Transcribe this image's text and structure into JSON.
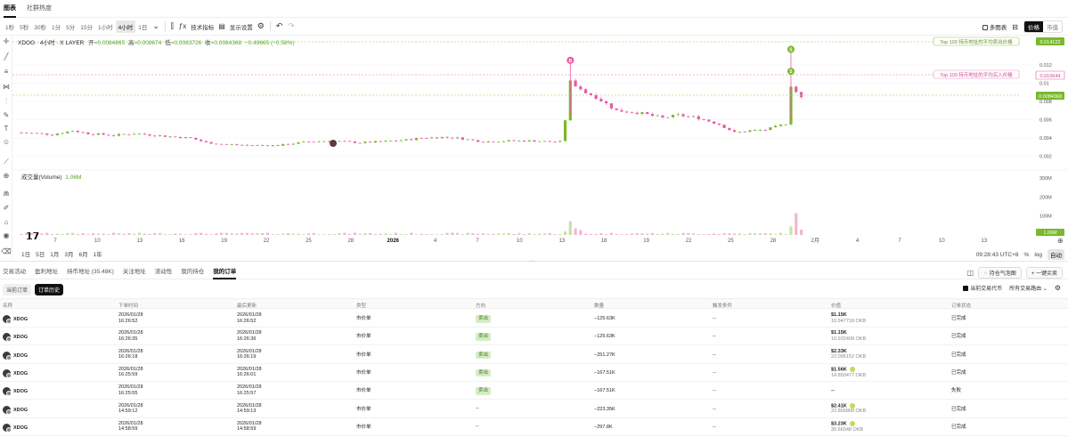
{
  "top_tabs": [
    "图表",
    "社群热度"
  ],
  "toolbar": {
    "intervals": [
      "1秒",
      "5秒",
      "30秒",
      "1分",
      "5分",
      "15分",
      "1小时",
      "4小时",
      "1日"
    ],
    "active_interval": "4小时",
    "indicators_label": "技术指标",
    "display_label": "显示设置",
    "multi_chart_label": "多图表",
    "price_label": "价格",
    "mcap_label": "市值"
  },
  "legend": {
    "symbol": "XDOG · 4小时 · X LAYER",
    "o_label": "开",
    "o_value": "=0.0084865",
    "h_label": "高",
    "h_value": "=0.008674",
    "l_label": "低",
    "l_value": "=0.0083726",
    "c_label": "收",
    "c_value": "=0.0084368",
    "change": "−0.49665 (−0.58%)"
  },
  "annotations": {
    "top_sell": "Top 100 持币地址的平均卖出价格",
    "top_buy": "Top 100 持币地址的平均买入价格",
    "sell_price": "0.014122",
    "buy_price": "0.010644",
    "current_price": "0.0084368"
  },
  "volume_legend": {
    "label": "成交量(Volume)",
    "value": "1.06M"
  },
  "time": "09:28:43 UTC+8",
  "range_buttons": [
    "1日",
    "5日",
    "1月",
    "3月",
    "6月",
    "1年"
  ],
  "scale_buttons": [
    "%",
    "log",
    "自动"
  ],
  "panel_tabs": [
    "交易活动",
    "盈利地址",
    "持币地址 (35.48K)",
    "关注地址",
    "流动性",
    "我的持仓",
    "我的订单"
  ],
  "panel_right": {
    "sentiment_label": "持仓气泡图",
    "sell_all_label": "一键买卖"
  },
  "sub_tabs": [
    "当前订单",
    "订单历史"
  ],
  "sub_right": {
    "filter_label": "当前交易代币",
    "group_label": "所有交易路由"
  },
  "table_headers": [
    "名称",
    "下单时间",
    "最后更新",
    "类型",
    "方向",
    "数量",
    "触发条件",
    "价值",
    "订单状态"
  ],
  "orders": [
    {
      "name": "XDOG",
      "order_date": "2026/01/28",
      "order_time": "16:26:52",
      "upd_date": "2026/01/28",
      "upd_time": "16:26:52",
      "type": "市价单",
      "side": "卖出",
      "qty": "−125.63K",
      "trigger": "--",
      "value": "$1.15K",
      "value_sub": "10.947718 OKB",
      "status": "已完成",
      "status_kind": "done",
      "badge": false
    },
    {
      "name": "XDOG",
      "order_date": "2026/01/28",
      "order_time": "16:26:35",
      "upd_date": "2026/01/28",
      "upd_time": "16:26:36",
      "type": "市价单",
      "side": "卖出",
      "qty": "−125.63K",
      "trigger": "--",
      "value": "$1.15K",
      "value_sub": "10.932408 OKB",
      "status": "已完成",
      "status_kind": "done",
      "badge": false
    },
    {
      "name": "XDOG",
      "order_date": "2026/01/28",
      "order_time": "16:26:18",
      "upd_date": "2026/01/28",
      "upd_time": "16:26:19",
      "type": "市价单",
      "side": "卖出",
      "qty": "−251.27K",
      "trigger": "--",
      "value": "$2.33K",
      "value_sub": "22.095152 OKB",
      "status": "已完成",
      "status_kind": "done",
      "badge": false
    },
    {
      "name": "XDOG",
      "order_date": "2026/01/28",
      "order_time": "16:25:59",
      "upd_date": "2026/01/28",
      "upd_time": "16:26:01",
      "type": "市价单",
      "side": "卖出",
      "qty": "−167.51K",
      "trigger": "--",
      "value": "$1.56K",
      "value_sub": "14.850477 OKB",
      "status": "已完成",
      "status_kind": "done",
      "badge": true
    },
    {
      "name": "XDOG",
      "order_date": "2026/01/28",
      "order_time": "16:25:55",
      "upd_date": "2026/01/28",
      "upd_time": "16:25:57",
      "type": "市价单",
      "side": "卖出",
      "qty": "−167.51K",
      "trigger": "--",
      "value": "--",
      "value_sub": "",
      "status": "失败",
      "status_kind": "fail",
      "badge": false
    },
    {
      "name": "XDOG",
      "order_date": "2026/01/28",
      "order_time": "14:59:12",
      "upd_date": "2026/01/28",
      "upd_time": "14:59:13",
      "type": "市价单",
      "side": "--",
      "qty": "−223.35K",
      "trigger": "--",
      "value": "$2.41K",
      "value_sub": "22.856808 OKB",
      "status": "已完成",
      "status_kind": "done",
      "badge": true
    },
    {
      "name": "XDOG",
      "order_date": "2026/01/28",
      "order_time": "14:58:59",
      "upd_date": "2026/01/28",
      "upd_time": "14:58:59",
      "type": "市价单",
      "side": "--",
      "qty": "−297.8K",
      "trigger": "--",
      "value": "$3.23K",
      "value_sub": "30.68348 OKB",
      "status": "已完成",
      "status_kind": "done",
      "badge": true
    }
  ],
  "colors": {
    "up": "#7ab82e",
    "down": "#e85aa6",
    "accent": "#7ab82e"
  },
  "chart_data": {
    "type": "candlestick",
    "x_ticks": [
      "7",
      "10",
      "13",
      "16",
      "19",
      "22",
      "25",
      "28",
      "2026",
      "4",
      "7",
      "10",
      "13",
      "16",
      "19",
      "22",
      "25",
      "28",
      "2月",
      "4",
      "7",
      "10",
      "13"
    ],
    "y_ticks": [
      "0.012",
      "0.01",
      "0.008",
      "0.006",
      "0.004",
      "0.002"
    ],
    "y_range": [
      0.0008,
      0.0152
    ],
    "volume_ticks": [
      "300M",
      "200M",
      "100M"
    ],
    "volume_range": [
      0,
      310
    ],
    "price_path": [
      [
        0,
        0.0046
      ],
      [
        6,
        0.0044
      ],
      [
        10,
        0.0048
      ],
      [
        13,
        0.0045
      ],
      [
        18,
        0.0043
      ],
      [
        22,
        0.0045
      ],
      [
        28,
        0.0042
      ],
      [
        33,
        0.004
      ],
      [
        36,
        0.0035
      ],
      [
        40,
        0.0033
      ],
      [
        45,
        0.0032
      ],
      [
        50,
        0.0032
      ],
      [
        53,
        0.0034
      ],
      [
        56,
        0.0036
      ],
      [
        60,
        0.0037
      ],
      [
        63,
        0.0036
      ],
      [
        66,
        0.0035
      ],
      [
        70,
        0.0036
      ],
      [
        75,
        0.0038
      ],
      [
        78,
        0.004
      ],
      [
        82,
        0.0041
      ],
      [
        85,
        0.004
      ],
      [
        90,
        0.0036
      ],
      [
        95,
        0.0037
      ],
      [
        100,
        0.0037
      ],
      [
        103,
        0.0036
      ],
      [
        105,
        0.0036
      ],
      [
        106,
        0.006
      ],
      [
        107,
        0.0102
      ],
      [
        109,
        0.0092
      ],
      [
        112,
        0.0085
      ],
      [
        116,
        0.007
      ],
      [
        120,
        0.0068
      ],
      [
        125,
        0.0062
      ],
      [
        128,
        0.0065
      ],
      [
        132,
        0.0062
      ],
      [
        136,
        0.0055
      ],
      [
        139,
        0.0046
      ],
      [
        142,
        0.0048
      ],
      [
        145,
        0.0049
      ],
      [
        147,
        0.0052
      ],
      [
        149,
        0.0056
      ],
      [
        150,
        0.0098
      ],
      [
        151,
        0.0089
      ],
      [
        152,
        0.0084
      ]
    ],
    "volume_spikes": [
      [
        106,
        18
      ],
      [
        107,
        72
      ],
      [
        108,
        35
      ],
      [
        109,
        26
      ],
      [
        150,
        45
      ],
      [
        151,
        115
      ],
      [
        152,
        28
      ]
    ],
    "markers": [
      {
        "x": 107,
        "y": 0.0125,
        "label": "B",
        "kind": "buy"
      },
      {
        "x": 150,
        "y": 0.0137,
        "label": "S",
        "kind": "sell"
      },
      {
        "x": 150,
        "y": 0.0113,
        "label": "S",
        "kind": "sell"
      }
    ]
  }
}
